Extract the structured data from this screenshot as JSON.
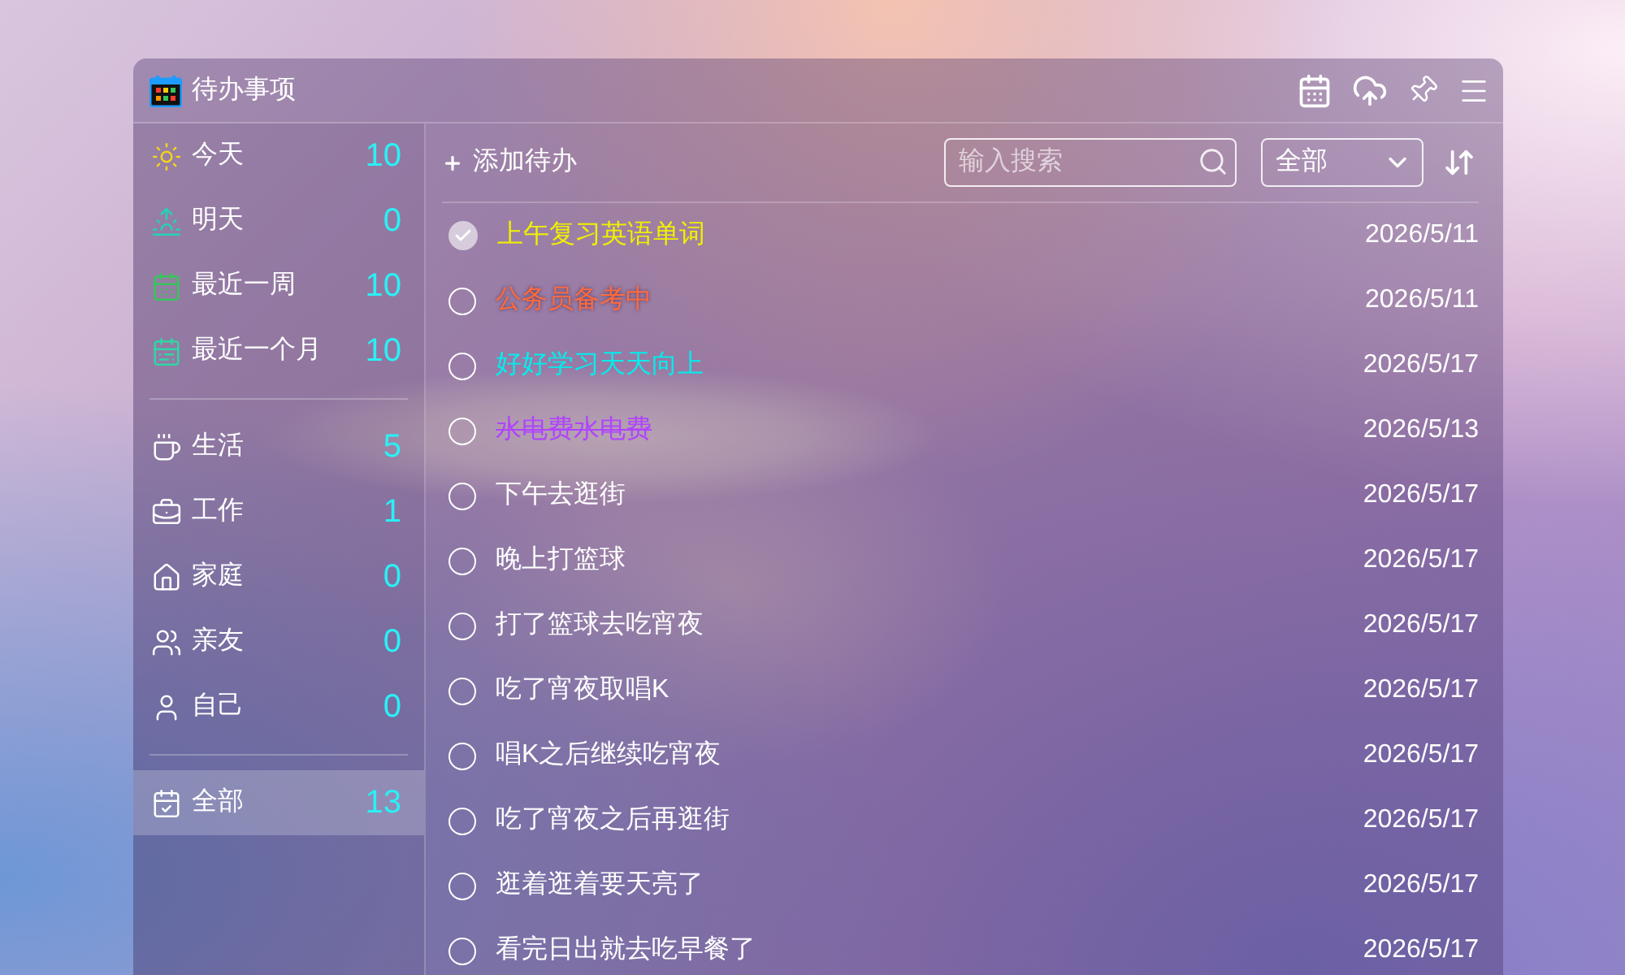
{
  "window": {
    "title": "待办事项"
  },
  "sidebar": {
    "sections": [
      {
        "items": [
          {
            "label": "今天",
            "count": "10",
            "selected": false
          },
          {
            "label": "明天",
            "count": "0",
            "selected": false
          },
          {
            "label": "最近一周",
            "count": "10",
            "selected": false
          },
          {
            "label": "最近一个月",
            "count": "10",
            "selected": false
          }
        ]
      },
      {
        "items": [
          {
            "label": "生活",
            "count": "5",
            "selected": false
          },
          {
            "label": "工作",
            "count": "1",
            "selected": false
          },
          {
            "label": "家庭",
            "count": "0",
            "selected": false
          },
          {
            "label": "亲友",
            "count": "0",
            "selected": false
          },
          {
            "label": "自己",
            "count": "0",
            "selected": false
          }
        ]
      },
      {
        "items": [
          {
            "label": "全部",
            "count": "13",
            "selected": true
          }
        ]
      }
    ]
  },
  "toolbar": {
    "add_label": "添加待办",
    "search": {
      "placeholder": "输入搜索"
    },
    "filter": {
      "value": "全部"
    }
  },
  "todos": [
    {
      "title": "上午复习英语单词",
      "date": "2026/5/11",
      "done": true,
      "struck": false,
      "color": "#f0f000"
    },
    {
      "title": "公务员备考中",
      "date": "2026/5/11",
      "done": false,
      "struck": false,
      "color": "#ff6a3c"
    },
    {
      "title": "好好学习天天向上",
      "date": "2026/5/17",
      "done": false,
      "struck": false,
      "color": "#00eeee"
    },
    {
      "title": "水电费水电费",
      "date": "2026/5/13",
      "done": false,
      "struck": true,
      "color": "#b044ff"
    },
    {
      "title": "下午去逛街",
      "date": "2026/5/17",
      "done": false,
      "struck": false,
      "color": "#ffffff"
    },
    {
      "title": "晚上打篮球",
      "date": "2026/5/17",
      "done": false,
      "struck": false,
      "color": "#ffffff"
    },
    {
      "title": "打了篮球去吃宵夜",
      "date": "2026/5/17",
      "done": false,
      "struck": false,
      "color": "#ffffff"
    },
    {
      "title": "吃了宵夜取唱K",
      "date": "2026/5/17",
      "done": false,
      "struck": false,
      "color": "#ffffff"
    },
    {
      "title": "唱K之后继续吃宵夜",
      "date": "2026/5/17",
      "done": false,
      "struck": false,
      "color": "#ffffff"
    },
    {
      "title": "吃了宵夜之后再逛街",
      "date": "2026/5/17",
      "done": false,
      "struck": false,
      "color": "#ffffff"
    },
    {
      "title": "逛着逛着要天亮了",
      "date": "2026/5/17",
      "done": false,
      "struck": false,
      "color": "#ffffff"
    },
    {
      "title": "看完日出就去吃早餐了",
      "date": "2026/5/17",
      "done": false,
      "struck": false,
      "color": "#ffffff"
    }
  ]
}
